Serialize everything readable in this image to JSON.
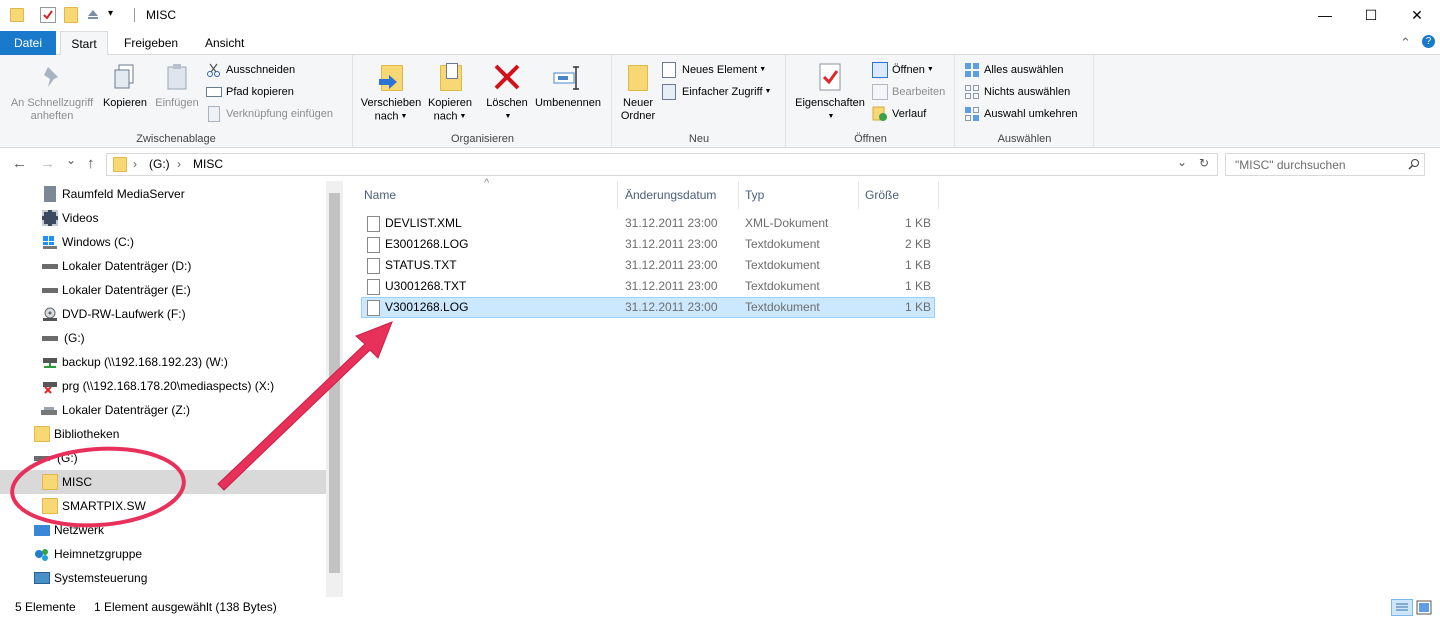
{
  "window": {
    "title": "MISC",
    "minimize_glyph": "—",
    "maximize_glyph": "☐",
    "close_glyph": "✕"
  },
  "ribbon_tabs": {
    "file": "Datei",
    "start": "Start",
    "share": "Freigeben",
    "view": "Ansicht",
    "collapse_glyph": "⌃",
    "help_glyph": "?"
  },
  "ribbon": {
    "clipboard": {
      "label": "Zwischenablage",
      "pin_line1": "An Schnellzugriff",
      "pin_line2": "anheften",
      "copy": "Kopieren",
      "paste": "Einfügen",
      "cut": "Ausschneiden",
      "copy_path": "Pfad kopieren",
      "paste_shortcut": "Verknüpfung einfügen"
    },
    "organize": {
      "label": "Organisieren",
      "move_line1": "Verschieben",
      "move_line2": "nach",
      "copy_line1": "Kopieren",
      "copy_line2": "nach",
      "delete": "Löschen",
      "rename": "Umbenennen"
    },
    "new": {
      "label": "Neu",
      "folder_line1": "Neuer",
      "folder_line2": "Ordner",
      "new_item": "Neues Element",
      "easy_access": "Einfacher Zugriff"
    },
    "open": {
      "label": "Öffnen",
      "properties": "Eigenschaften",
      "open": "Öffnen",
      "edit": "Bearbeiten",
      "history": "Verlauf"
    },
    "select": {
      "label": "Auswählen",
      "select_all": "Alles auswählen",
      "select_none": "Nichts auswählen",
      "invert": "Auswahl umkehren"
    }
  },
  "address": {
    "back_glyph": "←",
    "forward_glyph": "→",
    "recent_glyph": "⌄",
    "up_glyph": "↑",
    "crumb_sep1": "›",
    "crumb_drive": "(G:)",
    "crumb_sep2": "›",
    "crumb_folder": "MISC",
    "dropdown_glyph": "⌄",
    "refresh_glyph": "↻",
    "search_placeholder": "\"MISC\" durchsuchen"
  },
  "nav_pane": {
    "items": [
      {
        "label": "Raumfeld MediaServer",
        "icon": "media-server-icon"
      },
      {
        "label": "Videos",
        "icon": "videos-icon"
      },
      {
        "label": "Windows (C:)",
        "icon": "windows-drive-icon"
      },
      {
        "label": "Lokaler Datenträger (D:)",
        "icon": "drive-icon"
      },
      {
        "label": "Lokaler Datenträger (E:)",
        "icon": "drive-icon"
      },
      {
        "label": "DVD-RW-Laufwerk (F:)",
        "icon": "dvd-drive-icon"
      },
      {
        "label": "(G:)",
        "icon": "drive-icon"
      },
      {
        "label": "backup (\\\\192.168.192.23) (W:)",
        "icon": "network-drive-icon"
      },
      {
        "label": "prg (\\\\192.168.178.20\\mediaspects) (X:)",
        "icon": "disconnected-network-drive-icon"
      },
      {
        "label": "Lokaler Datenträger (Z:)",
        "icon": "drive-icon"
      },
      {
        "label": "Bibliotheken",
        "icon": "libraries-icon"
      },
      {
        "label": "(G:)",
        "icon": "drive-icon"
      },
      {
        "label": "MISC",
        "icon": "folder-icon"
      },
      {
        "label": "SMARTPIX.SW",
        "icon": "folder-icon"
      },
      {
        "label": "Netzwerk",
        "icon": "network-icon"
      },
      {
        "label": "Heimnetzgruppe",
        "icon": "homegroup-icon"
      },
      {
        "label": "Systemsteuerung",
        "icon": "control-panel-icon"
      }
    ]
  },
  "file_list": {
    "sort_glyph": "^",
    "columns": [
      "Name",
      "Änderungsdatum",
      "Typ",
      "Größe"
    ],
    "rows": [
      {
        "name": "DEVLIST.XML",
        "date": "31.12.2011 23:00",
        "type": "XML-Dokument",
        "size": "1 KB"
      },
      {
        "name": "E3001268.LOG",
        "date": "31.12.2011 23:00",
        "type": "Textdokument",
        "size": "2 KB"
      },
      {
        "name": "STATUS.TXT",
        "date": "31.12.2011 23:00",
        "type": "Textdokument",
        "size": "1 KB"
      },
      {
        "name": "U3001268.TXT",
        "date": "31.12.2011 23:00",
        "type": "Textdokument",
        "size": "1 KB"
      },
      {
        "name": "V3001268.LOG",
        "date": "31.12.2011 23:00",
        "type": "Textdokument",
        "size": "1 KB"
      }
    ],
    "selected_index": 4
  },
  "status": {
    "count": "5 Elemente",
    "selection": "1 Element ausgewählt (138 Bytes)"
  },
  "colors": {
    "accent": "#1979ca",
    "selection_bg": "#cce8ff",
    "annotation": "#e8315a"
  }
}
